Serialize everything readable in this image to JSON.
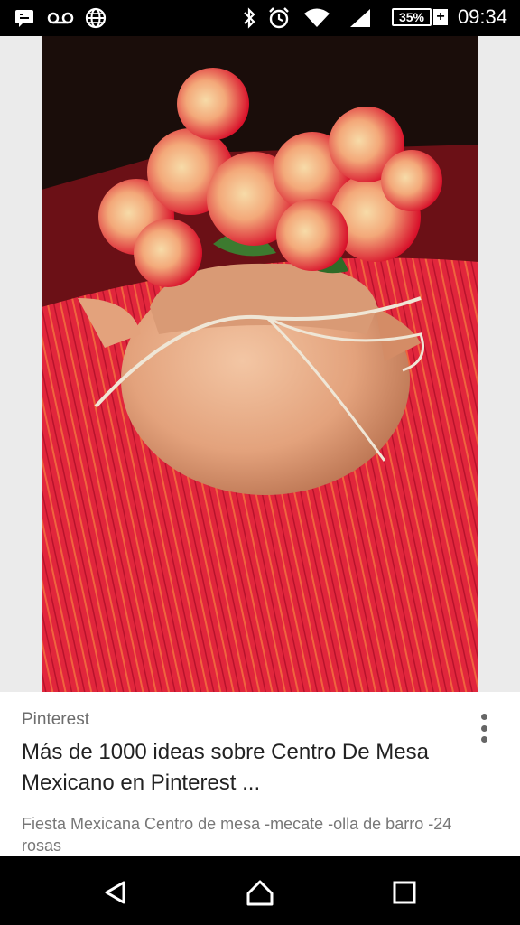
{
  "status_bar": {
    "time": "09:34",
    "battery_percent": "35%",
    "icons": [
      "notification-icon",
      "voicemail-icon",
      "globe-icon",
      "bluetooth-icon",
      "alarm-icon",
      "wifi-icon",
      "signal-icon",
      "battery-icon",
      "charging-icon"
    ]
  },
  "image": {
    "description_icon": "photo"
  },
  "result": {
    "source": "Pinterest",
    "title": "Más de 1000 ideas sobre Centro De Mesa Mexicano en Pinterest ...",
    "snippet": "Fiesta Mexicana Centro de mesa -mecate -olla de barro -24 rosas"
  },
  "nav": {
    "buttons": [
      "back-icon",
      "home-icon",
      "recents-icon"
    ]
  }
}
